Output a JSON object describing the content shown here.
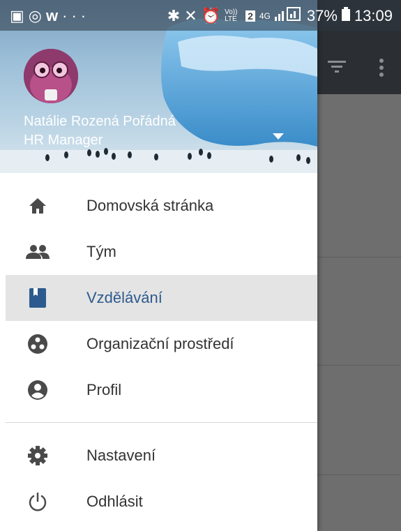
{
  "status_bar": {
    "left_icons": [
      "gallery-icon",
      "clock-sync-icon",
      "w-app-icon",
      "more-dots-icon"
    ],
    "right_icons": [
      "bluetooth-icon",
      "mute-icon",
      "alarm-icon",
      "volte-icon",
      "sim2-icon",
      "4g-icon",
      "signal-icon"
    ],
    "volte_text": "Vo)) LTE",
    "sim_text": "2",
    "network_text": "4G",
    "battery": "37%",
    "time": "13:09"
  },
  "app_bar": {
    "icons": [
      "filter-icon",
      "overflow-menu-icon"
    ]
  },
  "user": {
    "name": "Natálie Rozená Pořádná",
    "role": "HR Manager"
  },
  "menu": [
    {
      "label": "Domovská stránka",
      "icon": "home-icon"
    },
    {
      "label": "Tým",
      "icon": "people-icon"
    },
    {
      "label": "Vzdělávání",
      "icon": "book-icon",
      "active": true
    },
    {
      "label": "Organizační prostředí",
      "icon": "org-icon"
    },
    {
      "label": "Profil",
      "icon": "profile-icon"
    },
    {
      "label": "Nastavení",
      "icon": "settings-icon"
    },
    {
      "label": "Odhlásit",
      "icon": "power-icon"
    }
  ],
  "colors": {
    "active_text": "#2d5a8e",
    "active_bg": "#e4e4e4",
    "icon_gray": "#4a4a4a",
    "app_bar": "#2b2f33"
  }
}
